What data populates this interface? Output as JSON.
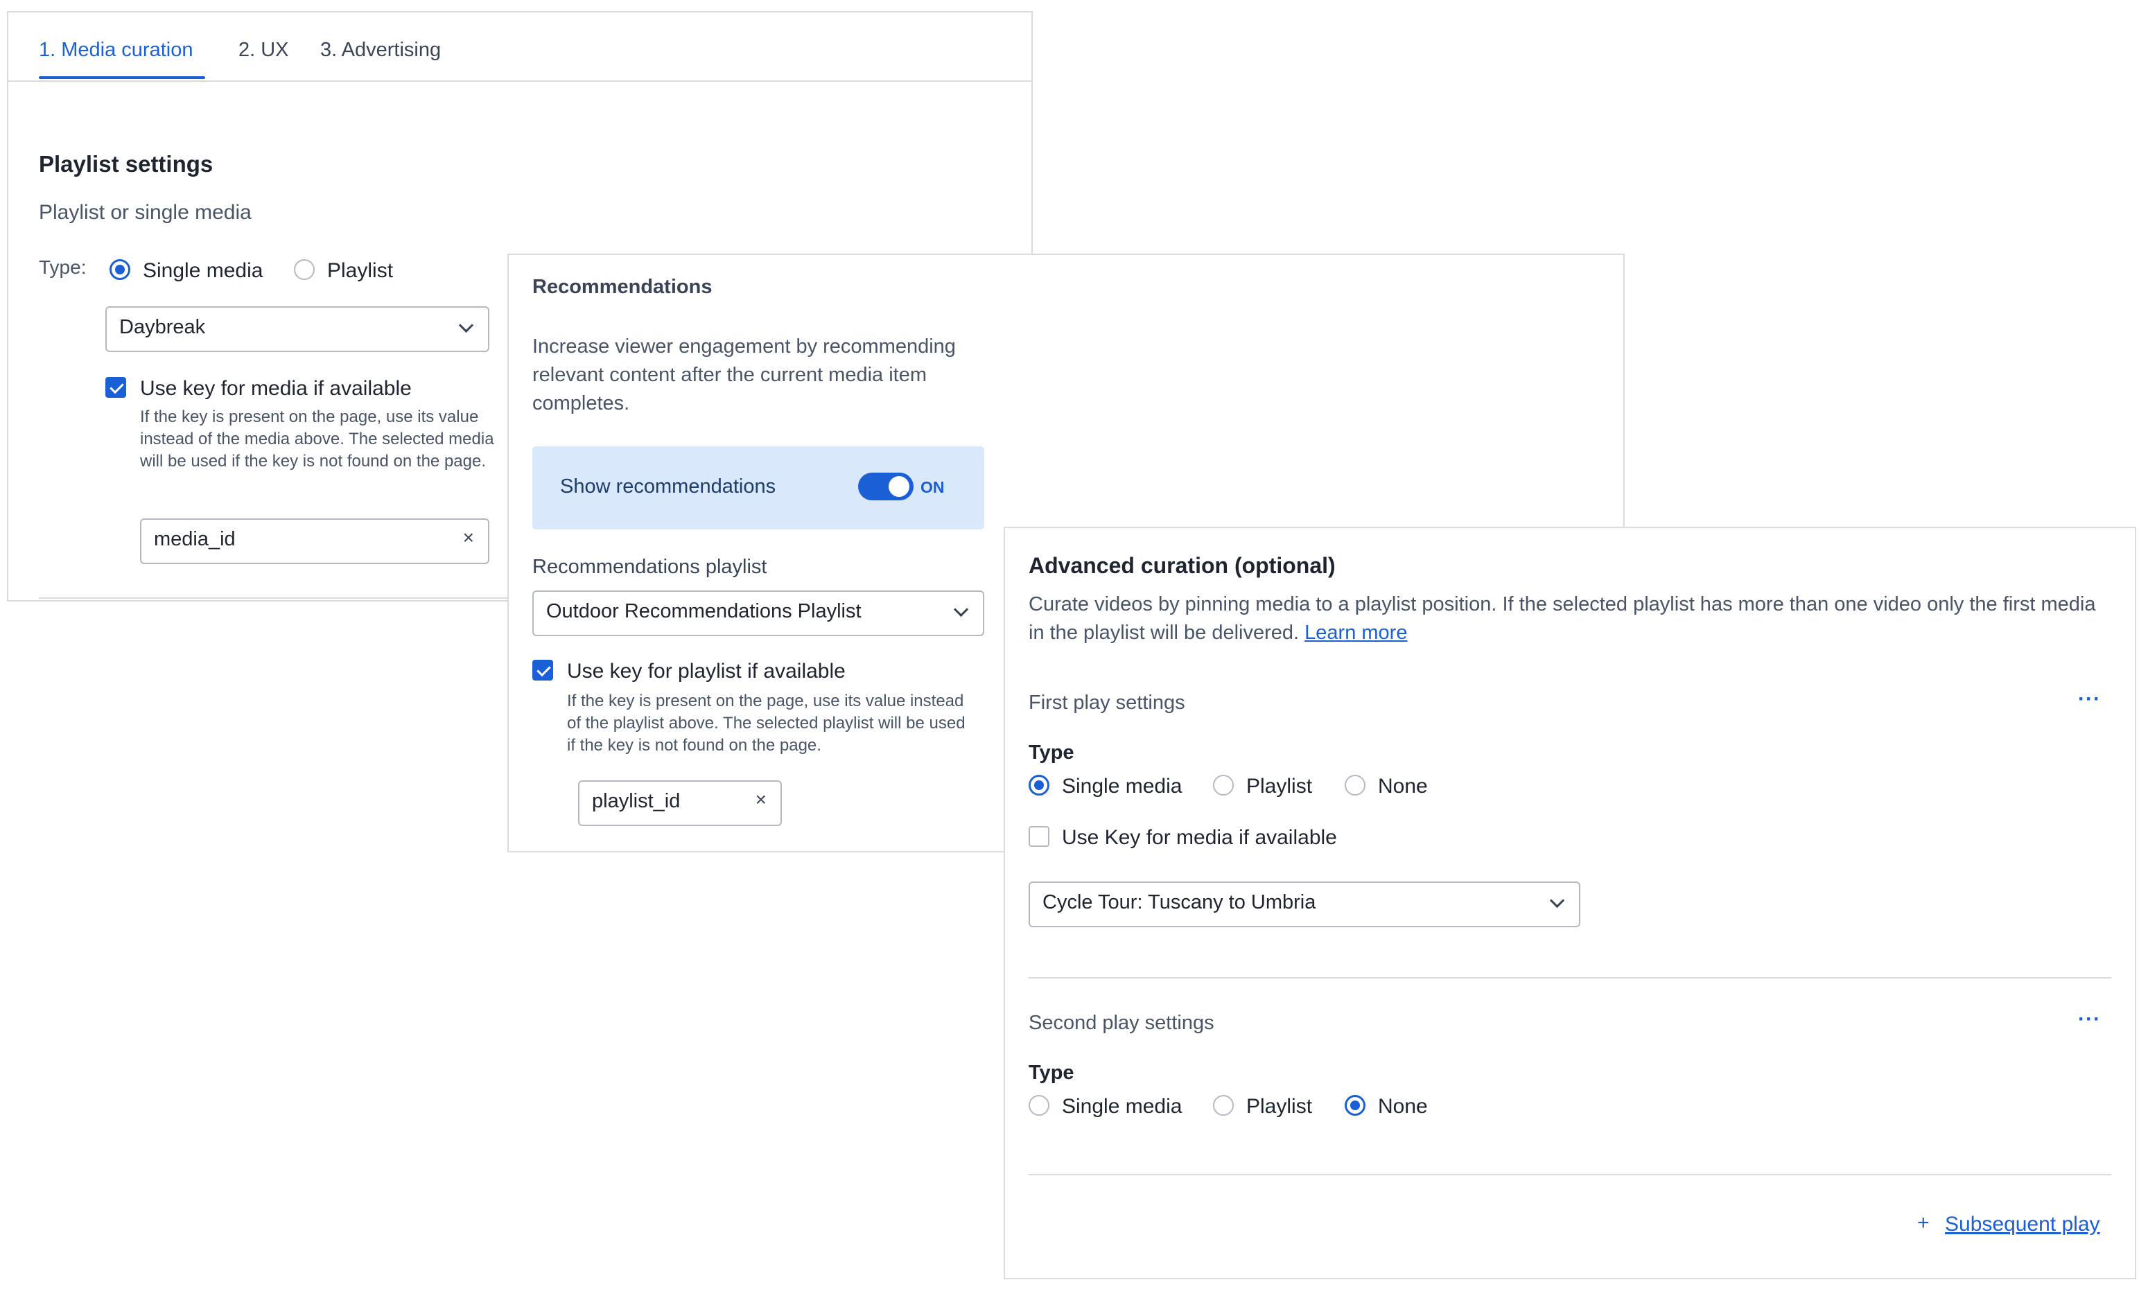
{
  "tabs": [
    {
      "label": "1. Media curation"
    },
    {
      "label": "2. UX"
    },
    {
      "label": "3. Advertising"
    }
  ],
  "playlist_settings": {
    "title": "Playlist settings",
    "subtitle": "Playlist or single media",
    "type_label": "Type:",
    "option_single": "Single media",
    "option_playlist": "Playlist",
    "select_value": "Daybreak",
    "use_key_label": "Use key for media if available",
    "use_key_help": "If the key is present on the page, use its value instead of the media above. The selected media will be used if the key is not found on the page.",
    "key_value": "media_id",
    "clear": "×"
  },
  "recommendations": {
    "title": "Recommendations",
    "description": "Increase viewer engagement by recommending relevant content after the current media item completes.",
    "toggle_label": "Show recommendations",
    "toggle_state": "ON",
    "playlist_label": "Recommendations playlist",
    "playlist_value": "Outdoor Recommendations Playlist",
    "use_key_label": "Use key for playlist if available",
    "use_key_help": "If the key is present on the page, use its value instead of the playlist above. The selected playlist will be used if the key is not found on the page.",
    "key_value": "playlist_id",
    "clear": "×"
  },
  "advanced": {
    "title": "Advanced curation (optional)",
    "description": "Curate videos by pinning media to a playlist position. If the selected playlist has more than one video only the first media in the playlist will be delivered.",
    "learn_more": "Learn more",
    "first_play": {
      "title": "First play settings",
      "type_label": "Type",
      "option_single": "Single media",
      "option_playlist": "Playlist",
      "option_none": "None",
      "use_key_label": "Use Key for media if available",
      "select_value": "Cycle Tour: Tuscany to Umbria",
      "more": "···"
    },
    "second_play": {
      "title": "Second play settings",
      "type_label": "Type",
      "option_single": "Single media",
      "option_playlist": "Playlist",
      "option_none": "None",
      "more": "···"
    },
    "subsequent_plus": "+",
    "subsequent_link": "Subsequent play"
  },
  "colors": {
    "accent": "#1b5fd6",
    "toggle_bg": "#d9e9fb",
    "border": "#d9dbe0"
  }
}
